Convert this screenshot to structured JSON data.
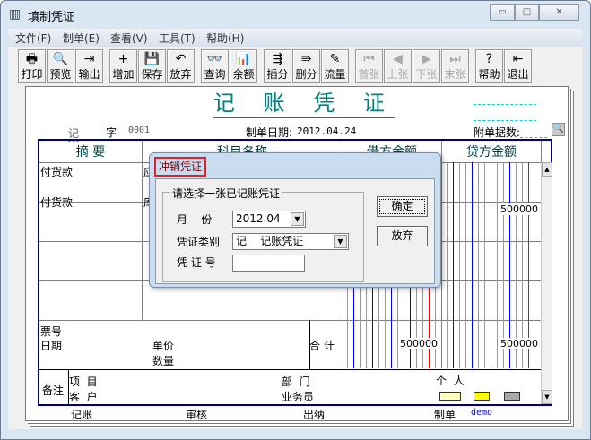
{
  "window": {
    "title": "填制凭证",
    "minimize": "▭",
    "maximize": "□",
    "close": "✕"
  },
  "menu": [
    "文件(F)",
    "制单(E)",
    "查看(V)",
    "工具(T)",
    "帮助(H)"
  ],
  "toolbar": [
    {
      "label": "打印",
      "icon": "🖶",
      "name": "print",
      "enabled": true
    },
    {
      "label": "预览",
      "icon": "🔍",
      "name": "preview",
      "enabled": true
    },
    {
      "label": "输出",
      "icon": "⇥",
      "name": "export",
      "enabled": true
    },
    {
      "label": "增加",
      "icon": "+",
      "name": "add",
      "enabled": true
    },
    {
      "label": "保存",
      "icon": "💾",
      "name": "save",
      "enabled": true
    },
    {
      "label": "放弃",
      "icon": "↶",
      "name": "discard",
      "enabled": true
    },
    {
      "label": "查询",
      "icon": "👓",
      "name": "query",
      "enabled": true
    },
    {
      "label": "余额",
      "icon": "📊",
      "name": "balance",
      "enabled": true
    },
    {
      "label": "插分",
      "icon": "⇶",
      "name": "insert-line",
      "enabled": true
    },
    {
      "label": "删分",
      "icon": "⇛",
      "name": "delete-line",
      "enabled": true
    },
    {
      "label": "流量",
      "icon": "✎",
      "name": "cashflow",
      "enabled": true
    },
    {
      "label": "首张",
      "icon": "⏮",
      "name": "first",
      "enabled": false
    },
    {
      "label": "上张",
      "icon": "◀",
      "name": "prev",
      "enabled": false
    },
    {
      "label": "下张",
      "icon": "▶",
      "name": "next",
      "enabled": false
    },
    {
      "label": "末张",
      "icon": "⏭",
      "name": "last",
      "enabled": false
    },
    {
      "label": "帮助",
      "icon": "?",
      "name": "help",
      "enabled": true
    },
    {
      "label": "退出",
      "icon": "⇤",
      "name": "exit",
      "enabled": true
    }
  ],
  "voucher": {
    "title": "记 账 凭 证",
    "type": "记",
    "zi": "字",
    "number": "0001",
    "date_label": "制单日期:",
    "date": "2012.04.24",
    "attach_label": "附单据数:",
    "headers": {
      "summary": "摘 要",
      "account": "科目名称",
      "debit": "借方金额",
      "credit": "贷方金额"
    },
    "rows": [
      {
        "summary": "付货款",
        "account": "应",
        "debit": "",
        "credit": ""
      },
      {
        "summary": "付货款",
        "account": "库",
        "debit": "",
        "credit": "500000"
      }
    ],
    "ticket_label": "票号",
    "date_row_label": "日期",
    "price_label": "单价",
    "qty_label": "数量",
    "total_label": "合 计",
    "total_debit": "500000",
    "total_credit": "500000",
    "remark_label": "备注",
    "project_label": "项  目",
    "customer_label": "客  户",
    "dept_label": "部  门",
    "salesman_label": "业务员",
    "person_label": "个  人",
    "footer": {
      "posting": "记账",
      "audit": "审核",
      "cashier": "出纳",
      "maker": "制单",
      "maker_name": "demo"
    }
  },
  "dialog": {
    "title": "冲销凭证",
    "group_label": "请选择一张已记账凭证",
    "month_label": "月    份",
    "month_value": "2012.04",
    "type_label": "凭证类别",
    "type_value": "记    记账凭证",
    "number_label": "凭 证 号",
    "number_value": "",
    "ok": "确定",
    "cancel": "放弃"
  }
}
